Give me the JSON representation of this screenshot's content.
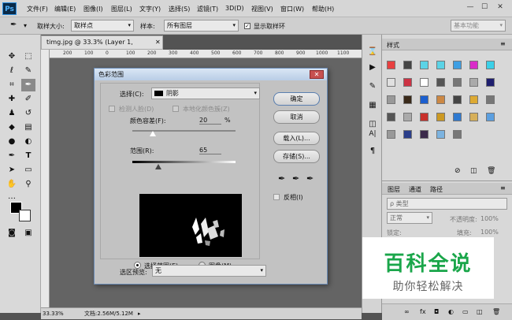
{
  "menubar": {
    "logo": "Ps",
    "items": [
      "文件(F)",
      "编辑(E)",
      "图像(I)",
      "图层(L)",
      "文字(Y)",
      "选择(S)",
      "滤镜(T)",
      "3D(D)",
      "视图(V)",
      "窗口(W)",
      "帮助(H)"
    ],
    "window_controls": [
      "—",
      "☐",
      "✕"
    ]
  },
  "optionbar": {
    "sample_size_label": "取样大小:",
    "sample_size_value": "取样点",
    "sample_label": "样本:",
    "sample_value": "所有图层",
    "show_ring_label": "显示取样环",
    "workspace": "基本功能"
  },
  "document": {
    "tab_title": "timg.jpg @ 33.3% (Layer 1, RGB/8#) *",
    "ruler_ticks": [
      "200",
      "100",
      "0",
      "100",
      "200",
      "300",
      "400",
      "500",
      "600",
      "700",
      "800",
      "900",
      "1000",
      "1100"
    ],
    "zoom": "33.33%",
    "doc_size": "文档:2.56M/5.12M"
  },
  "dialog": {
    "title": "色彩范围",
    "close": "✕",
    "select_label": "选择(C):",
    "select_value": "阴影",
    "detect_faces": "检测人脸(D)",
    "localized_clusters": "本地化颜色簇(Z)",
    "fuzziness_label": "颜色容差(F):",
    "fuzziness_value": "20",
    "fuzziness_unit": "%",
    "fuzziness_level": 0.2,
    "range_label": "范围(R):",
    "range_value": "65",
    "range_level": 0.25,
    "radio_selection": "选择范围(E)",
    "radio_image": "图像(M)",
    "preview_label": "选区预览:",
    "preview_value": "无",
    "ok": "确定",
    "cancel": "取消",
    "load": "载入(L)...",
    "save": "存储(S)...",
    "invert": "反相(I)"
  },
  "panels": {
    "styles_tab": "样式",
    "layers_tabs": [
      "图层",
      "通道",
      "路径"
    ],
    "kind_filter": "ρ 类型",
    "blend_mode": "正常",
    "opacity_label": "不透明度:",
    "opacity_value": "100%",
    "lock_label": "锁定:",
    "fill_label": "填充:",
    "fill_value": "100%"
  },
  "watermark": {
    "main": "百科全说",
    "sub": "助你轻松解决"
  },
  "colors": {
    "accent_green": "#1aa64a",
    "swatches": [
      "#e84040",
      "#444",
      "#5bd3e6",
      "#5bd3e6",
      "#3f9fe3",
      "#d92cc8",
      "#3ad0e8",
      "#e0e0e0",
      "#cc3344",
      "#ffffff",
      "#555",
      "#777",
      "#aaa",
      "#1f1f6f",
      "#999",
      "#3a2a1a",
      "#1b5fcf",
      "#cc8844",
      "#444",
      "#ddaa33",
      "#777",
      "#555",
      "#aaa",
      "#c8302b",
      "#cc9922",
      "#2f7ad0",
      "#d7b05a",
      "#5b9fe0",
      "#999",
      "#2b3f8a",
      "#3b2a4a",
      "#7cb3e0",
      "#777"
    ]
  }
}
